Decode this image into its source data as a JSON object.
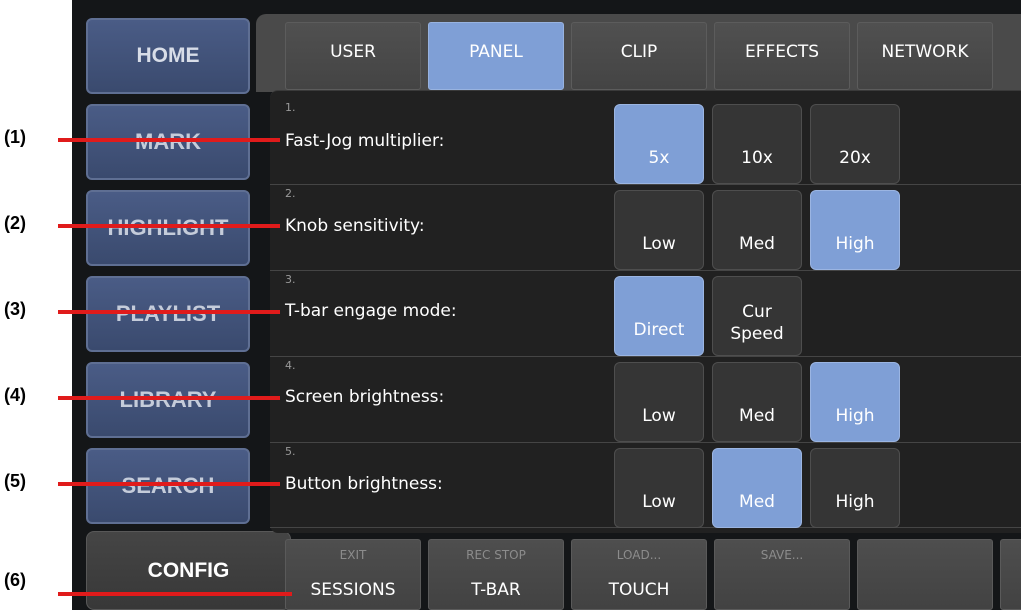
{
  "nav": {
    "home": "HOME",
    "mark": "MARK",
    "highlight": "HIGHLIGHT",
    "playlist": "PLAYLIST",
    "library": "LIBRARY",
    "search": "SEARCH",
    "config": "CONFIG"
  },
  "tabs": [
    "USER",
    "PANEL",
    "CLIP",
    "EFFECTS",
    "NETWORK"
  ],
  "active_tab": "PANEL",
  "settings": [
    {
      "num": "1.",
      "label": "Fast-Jog multiplier:",
      "options": [
        "5x",
        "10x",
        "20x"
      ],
      "selected": "5x"
    },
    {
      "num": "2.",
      "label": "Knob sensitivity:",
      "options": [
        "Low",
        "Med",
        "High"
      ],
      "selected": "High"
    },
    {
      "num": "3.",
      "label": "T-bar engage mode:",
      "options": [
        "Direct",
        "Cur Speed"
      ],
      "selected": "Direct"
    },
    {
      "num": "4.",
      "label": "Screen brightness:",
      "options": [
        "Low",
        "Med",
        "High"
      ],
      "selected": "High"
    },
    {
      "num": "5.",
      "label": "Button brightness:",
      "options": [
        "Low",
        "Med",
        "High"
      ],
      "selected": "Med"
    }
  ],
  "bottom_bar": [
    {
      "top": "EXIT",
      "main": "SESSIONS"
    },
    {
      "top": "REC STOP",
      "main": "T-BAR"
    },
    {
      "top": "LOAD...",
      "main": "TOUCH"
    },
    {
      "top": "SAVE...",
      "main": ""
    },
    {
      "top": "",
      "main": ""
    }
  ],
  "annotations": [
    "(1)",
    "(2)",
    "(3)",
    "(4)",
    "(5)",
    "(6)"
  ],
  "colors": {
    "selected": "#7f9fd6",
    "nav_blue": "#4a5c86",
    "callout_line": "#e01b1b"
  }
}
